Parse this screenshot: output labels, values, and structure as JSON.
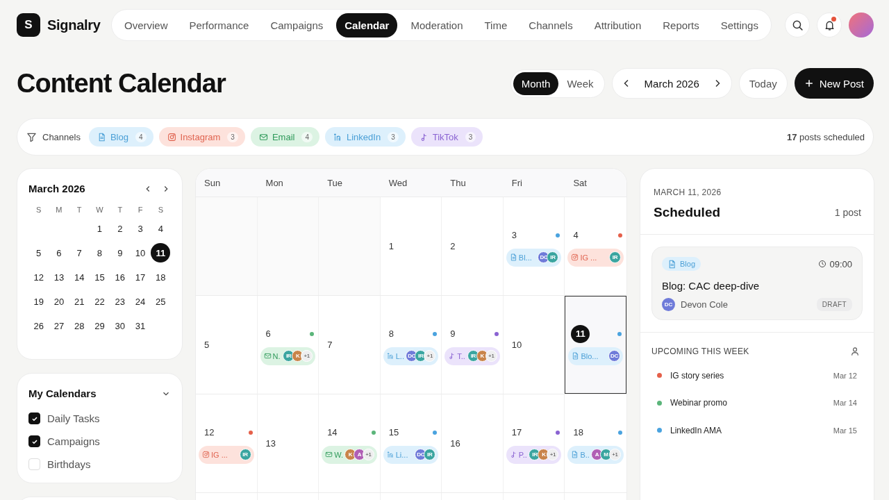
{
  "brand": {
    "logo_letter": "S",
    "name": "Signalry"
  },
  "nav": [
    {
      "label": "Overview",
      "selected": false
    },
    {
      "label": "Performance",
      "selected": false
    },
    {
      "label": "Campaigns",
      "selected": false
    },
    {
      "label": "Calendar",
      "selected": true
    },
    {
      "label": "Moderation",
      "selected": false
    },
    {
      "label": "Time",
      "selected": false
    },
    {
      "label": "Channels",
      "selected": false
    },
    {
      "label": "Attribution",
      "selected": false
    },
    {
      "label": "Reports",
      "selected": false
    },
    {
      "label": "Settings",
      "selected": false
    }
  ],
  "notifications": {
    "unread": true
  },
  "page_title": "Content Calendar",
  "view_toggle": [
    {
      "label": "Month",
      "selected": true
    },
    {
      "label": "Week",
      "selected": false
    }
  ],
  "period": "March 2026",
  "today_button": "Today",
  "new_post_button": "New Post",
  "filter": {
    "label": "Channels",
    "summary": "**17** posts scheduled",
    "channels": [
      {
        "kind": "blog",
        "label": "Blog",
        "count": "4"
      },
      {
        "kind": "instagram",
        "label": "Instagram",
        "count": "3"
      },
      {
        "kind": "email",
        "label": "Email",
        "count": "4"
      },
      {
        "kind": "linkedin",
        "label": "LinkedIn",
        "count": "3"
      },
      {
        "kind": "tiktok",
        "label": "TikTok",
        "count": "3"
      }
    ]
  },
  "mini_calendar": {
    "title": "March 2026",
    "weekdays": [
      "S",
      "M",
      "T",
      "W",
      "T",
      "F",
      "S"
    ],
    "weeks": [
      [
        {
          "day": "1",
          "selected": false
        },
        {
          "day": "2",
          "selected": false
        },
        {
          "day": "3",
          "selected": false
        },
        {
          "day": "4",
          "selected": false
        }
      ],
      [
        {
          "day": "5",
          "selected": false
        },
        {
          "day": "6",
          "selected": false
        },
        {
          "day": "7",
          "selected": false
        },
        {
          "day": "8",
          "selected": false
        },
        {
          "day": "9",
          "selected": false
        },
        {
          "day": "10",
          "selected": false
        },
        {
          "day": "11",
          "selected": true
        }
      ],
      [
        {
          "day": "12",
          "selected": false
        },
        {
          "day": "13",
          "selected": false
        },
        {
          "day": "14",
          "selected": false
        },
        {
          "day": "15",
          "selected": false
        },
        {
          "day": "16",
          "selected": false
        },
        {
          "day": "17",
          "selected": false
        },
        {
          "day": "18",
          "selected": false
        }
      ],
      [
        {
          "day": "19",
          "selected": false
        },
        {
          "day": "20",
          "selected": false
        },
        {
          "day": "21",
          "selected": false
        },
        {
          "day": "22",
          "selected": false
        },
        {
          "day": "23",
          "selected": false
        },
        {
          "day": "24",
          "selected": false
        },
        {
          "day": "25",
          "selected": false
        }
      ],
      [
        {
          "day": "26",
          "selected": false
        },
        {
          "day": "27",
          "selected": false
        },
        {
          "day": "28",
          "selected": false
        },
        {
          "day": "29",
          "selected": false
        },
        {
          "day": "30",
          "selected": false
        },
        {
          "day": "31",
          "selected": false
        }
      ]
    ]
  },
  "my_calendars": {
    "title": "My Calendars",
    "expanded": true,
    "items": [
      {
        "label": "Daily Tasks",
        "checked": true
      },
      {
        "label": "Campaigns",
        "checked": true
      },
      {
        "label": "Birthdays",
        "checked": false
      }
    ]
  },
  "calendar": {
    "weekdays": [
      "Sun",
      "Mon",
      "Tue",
      "Wed",
      "Thu",
      "Fri",
      "Sat"
    ],
    "weeks": [
      [
        {
          "kind": "outside"
        },
        {
          "kind": "outside"
        },
        {
          "kind": "outside"
        },
        {
          "kind": "day",
          "day": "1",
          "selected": false
        },
        {
          "kind": "day",
          "day": "2",
          "selected": false
        },
        {
          "kind": "day",
          "day": "3",
          "selected": false,
          "color": "#4aa3df",
          "post": {
            "kind": "blog",
            "label": "Bl...",
            "avatars": [
              {
                "initials": "DC",
                "color": "#6f7bd9"
              },
              {
                "initials": "IR",
                "color": "#3aa5a0"
              }
            ]
          }
        },
        {
          "kind": "day",
          "day": "4",
          "selected": false,
          "color": "#e5604a",
          "post": {
            "kind": "instagram",
            "label": "IG ...",
            "avatars": [
              {
                "initials": "IR",
                "color": "#3aa5a0"
              }
            ]
          }
        }
      ],
      [
        {
          "kind": "day",
          "day": "5",
          "selected": false
        },
        {
          "kind": "day",
          "day": "6",
          "selected": false,
          "color": "#5bb57a",
          "post": {
            "kind": "email",
            "label": "N.",
            "avatars": [
              {
                "initials": "IR",
                "color": "#3aa5a0"
              },
              {
                "initials": "K",
                "color": "#c9844a"
              }
            ],
            "more": "+1"
          }
        },
        {
          "kind": "day",
          "day": "7",
          "selected": false
        },
        {
          "kind": "day",
          "day": "8",
          "selected": false,
          "color": "#4aa3df",
          "post": {
            "kind": "linkedin",
            "label": "L..",
            "avatars": [
              {
                "initials": "DC",
                "color": "#6f7bd9"
              },
              {
                "initials": "IR",
                "color": "#3aa5a0"
              }
            ],
            "more": "+1"
          }
        },
        {
          "kind": "day",
          "day": "9",
          "selected": false,
          "color": "#8a63d2",
          "post": {
            "kind": "tiktok",
            "label": "T..",
            "avatars": [
              {
                "initials": "IR",
                "color": "#3aa5a0"
              },
              {
                "initials": "K",
                "color": "#c9844a"
              }
            ],
            "more": "+1"
          }
        },
        {
          "kind": "day",
          "day": "10",
          "selected": false
        },
        {
          "kind": "day",
          "day": "11",
          "selected": true,
          "color": "#4aa3df",
          "post": {
            "kind": "blog",
            "label": "Blo...",
            "avatars": [
              {
                "initials": "DC",
                "color": "#6f7bd9"
              }
            ]
          }
        }
      ],
      [
        {
          "kind": "day",
          "day": "12",
          "selected": false,
          "color": "#e5604a",
          "post": {
            "kind": "instagram",
            "label": "IG ...",
            "avatars": [
              {
                "initials": "IR",
                "color": "#3aa5a0"
              }
            ]
          }
        },
        {
          "kind": "day",
          "day": "13",
          "selected": false
        },
        {
          "kind": "day",
          "day": "14",
          "selected": false,
          "color": "#5bb57a",
          "post": {
            "kind": "email",
            "label": "W.",
            "avatars": [
              {
                "initials": "K",
                "color": "#c9844a"
              },
              {
                "initials": "A",
                "color": "#b05fb5"
              }
            ],
            "more": "+1"
          }
        },
        {
          "kind": "day",
          "day": "15",
          "selected": false,
          "color": "#4aa3df",
          "post": {
            "kind": "linkedin",
            "label": "Li...",
            "avatars": [
              {
                "initials": "DC",
                "color": "#6f7bd9"
              },
              {
                "initials": "IR",
                "color": "#3aa5a0"
              }
            ]
          }
        },
        {
          "kind": "day",
          "day": "16",
          "selected": false
        },
        {
          "kind": "day",
          "day": "17",
          "selected": false,
          "color": "#8a63d2",
          "post": {
            "kind": "tiktok",
            "label": "P..",
            "avatars": [
              {
                "initials": "IR",
                "color": "#3aa5a0"
              },
              {
                "initials": "K",
                "color": "#c9844a"
              }
            ],
            "more": "+1"
          }
        },
        {
          "kind": "day",
          "day": "18",
          "selected": false,
          "color": "#4aa3df",
          "post": {
            "kind": "blog",
            "label": "B..",
            "avatars": [
              {
                "initials": "A",
                "color": "#b05fb5"
              },
              {
                "initials": "M",
                "color": "#3aa5a0"
              }
            ],
            "more": "+1"
          }
        }
      ]
    ]
  },
  "day_panel": {
    "date": "MARCH 11, 2026",
    "title": "Scheduled",
    "count": "1 post",
    "posts": [
      {
        "kind": "blog",
        "channel": "Blog",
        "time": "09:00",
        "title": "Blog: CAC deep-dive",
        "author_initials": "DC",
        "author": "Devon Cole",
        "status": "DRAFT"
      }
    ]
  },
  "upcoming": {
    "title": "UPCOMING THIS WEEK",
    "items": [
      {
        "label": "IG story series",
        "date": "Mar 12",
        "color": "#e5604a"
      },
      {
        "label": "Webinar promo",
        "date": "Mar 14",
        "color": "#5bb57a"
      },
      {
        "label": "LinkedIn AMA",
        "date": "Mar 15",
        "color": "#4aa3df"
      }
    ]
  }
}
